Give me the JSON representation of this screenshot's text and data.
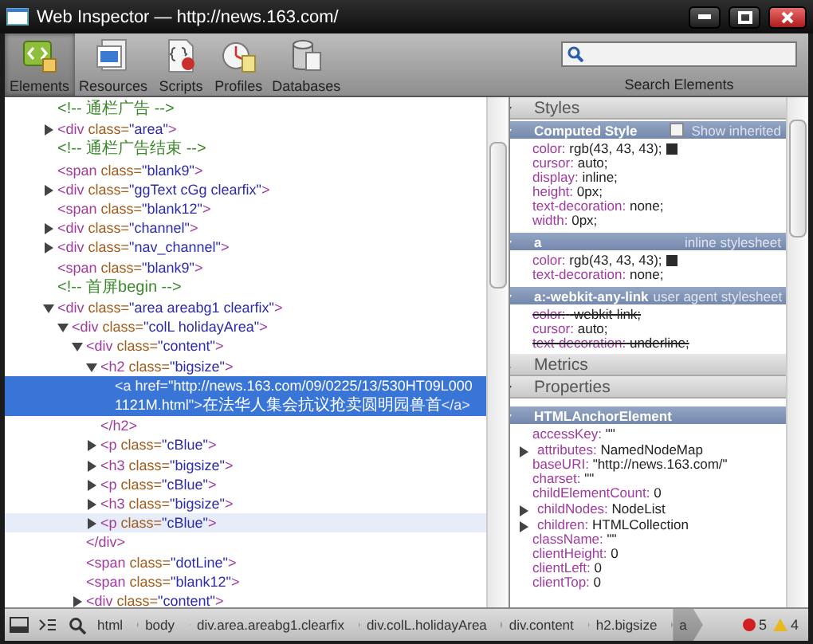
{
  "window": {
    "title": "Web Inspector — http://news.163.com/"
  },
  "toolbar": {
    "buttons": [
      {
        "label": "Elements",
        "kind": "elements",
        "selected": true
      },
      {
        "label": "Resources",
        "kind": "resources",
        "selected": false
      },
      {
        "label": "Scripts",
        "kind": "scripts",
        "selected": false
      },
      {
        "label": "Profiles",
        "kind": "profiles",
        "selected": false
      },
      {
        "label": "Databases",
        "kind": "databases",
        "selected": false
      }
    ],
    "search": {
      "label": "Search Elements"
    }
  },
  "dom_tree": [
    {
      "parts": [
        {
          "kind": "comment",
          "text": "<!-- 通栏广告 -->"
        }
      ],
      "selected": false,
      "hovered": false
    },
    {
      "parts": [
        {
          "kind": "tag",
          "text": "<div"
        },
        {
          "kind": "attr",
          "text": " class="
        },
        {
          "kind": "value",
          "text": "\"area\""
        },
        {
          "kind": "tag",
          "text": ">"
        }
      ],
      "expanded": false,
      "selected": false,
      "hovered": false
    },
    {
      "parts": [
        {
          "kind": "comment",
          "text": "<!-- 通栏广告结束 -->"
        }
      ],
      "selected": false,
      "hovered": false
    },
    {
      "parts": [
        {
          "kind": "tag",
          "text": "<span"
        },
        {
          "kind": "attr",
          "text": " class="
        },
        {
          "kind": "value",
          "text": "\"blank9\""
        },
        {
          "kind": "tag",
          "text": ">"
        }
      ],
      "selected": false,
      "hovered": false
    },
    {
      "parts": [
        {
          "kind": "tag",
          "text": "<div"
        },
        {
          "kind": "attr",
          "text": " class="
        },
        {
          "kind": "value",
          "text": "\"ggText cGg clearfix\""
        },
        {
          "kind": "tag",
          "text": ">"
        }
      ],
      "expanded": false,
      "selected": false,
      "hovered": false
    },
    {
      "parts": [
        {
          "kind": "tag",
          "text": "<span"
        },
        {
          "kind": "attr",
          "text": " class="
        },
        {
          "kind": "value",
          "text": "\"blank12\""
        },
        {
          "kind": "tag",
          "text": ">"
        }
      ],
      "selected": false,
      "hovered": false
    },
    {
      "parts": [
        {
          "kind": "tag",
          "text": "<div"
        },
        {
          "kind": "attr",
          "text": " class="
        },
        {
          "kind": "value",
          "text": "\"channel\""
        },
        {
          "kind": "tag",
          "text": ">"
        }
      ],
      "expanded": false,
      "selected": false,
      "hovered": false
    },
    {
      "parts": [
        {
          "kind": "tag",
          "text": "<div"
        },
        {
          "kind": "attr",
          "text": " class="
        },
        {
          "kind": "value",
          "text": "\"nav_channel\""
        },
        {
          "kind": "tag",
          "text": ">"
        }
      ],
      "expanded": false,
      "selected": false,
      "hovered": false
    },
    {
      "parts": [
        {
          "kind": "tag",
          "text": "<span"
        },
        {
          "kind": "attr",
          "text": " class="
        },
        {
          "kind": "value",
          "text": "\"blank9\""
        },
        {
          "kind": "tag",
          "text": ">"
        }
      ],
      "selected": false,
      "hovered": false
    },
    {
      "parts": [
        {
          "kind": "comment",
          "text": "<!-- 首屏begin -->"
        }
      ],
      "selected": false,
      "hovered": false
    },
    {
      "parts": [
        {
          "kind": "tag",
          "text": "<div"
        },
        {
          "kind": "attr",
          "text": " class="
        },
        {
          "kind": "value",
          "text": "\"area areabg1 clearfix\""
        },
        {
          "kind": "tag",
          "text": ">"
        }
      ],
      "expanded": true,
      "selected": false,
      "hovered": false,
      "children": [
        {
          "parts": [
            {
              "kind": "tag",
              "text": "<div"
            },
            {
              "kind": "attr",
              "text": " class="
            },
            {
              "kind": "value",
              "text": "\"colL holidayArea\""
            },
            {
              "kind": "tag",
              "text": ">"
            }
          ],
          "expanded": true,
          "selected": false,
          "hovered": false,
          "children": [
            {
              "parts": [
                {
                  "kind": "tag",
                  "text": "<div"
                },
                {
                  "kind": "attr",
                  "text": " class="
                },
                {
                  "kind": "value",
                  "text": "\"content\""
                },
                {
                  "kind": "tag",
                  "text": ">"
                }
              ],
              "expanded": true,
              "selected": false,
              "hovered": false,
              "closing": "</div>",
              "children": [
                {
                  "parts": [
                    {
                      "kind": "tag",
                      "text": "<h2"
                    },
                    {
                      "kind": "attr",
                      "text": " class="
                    },
                    {
                      "kind": "value",
                      "text": "\"bigsize\""
                    },
                    {
                      "kind": "tag",
                      "text": ">"
                    }
                  ],
                  "expanded": true,
                  "selected": false,
                  "hovered": false,
                  "closing": "</h2>",
                  "children": [
                    {
                      "parts": [
                        {
                          "kind": "tag",
                          "text": "<a"
                        },
                        {
                          "kind": "attr",
                          "text": " href="
                        },
                        {
                          "kind": "value",
                          "text": "\"http://news.163.com/09/0225/13/530HT09L0001121M.html\""
                        },
                        {
                          "kind": "tag",
                          "text": ">"
                        },
                        {
                          "kind": "text",
                          "text": "在法华人集会抗议抢卖圆明园兽首"
                        },
                        {
                          "kind": "tag",
                          "text": "</a>"
                        }
                      ],
                      "selected": true
                    }
                  ]
                },
                {
                  "parts": [
                    {
                      "kind": "tag",
                      "text": "<p"
                    },
                    {
                      "kind": "attr",
                      "text": " class="
                    },
                    {
                      "kind": "value",
                      "text": "\"cBlue\""
                    },
                    {
                      "kind": "tag",
                      "text": ">"
                    }
                  ],
                  "expanded": false,
                  "selected": false,
                  "hovered": false
                },
                {
                  "parts": [
                    {
                      "kind": "tag",
                      "text": "<h3"
                    },
                    {
                      "kind": "attr",
                      "text": " class="
                    },
                    {
                      "kind": "value",
                      "text": "\"bigsize\""
                    },
                    {
                      "kind": "tag",
                      "text": ">"
                    }
                  ],
                  "expanded": false,
                  "selected": false,
                  "hovered": false
                },
                {
                  "parts": [
                    {
                      "kind": "tag",
                      "text": "<p"
                    },
                    {
                      "kind": "attr",
                      "text": " class="
                    },
                    {
                      "kind": "value",
                      "text": "\"cBlue\""
                    },
                    {
                      "kind": "tag",
                      "text": ">"
                    }
                  ],
                  "expanded": false,
                  "selected": false,
                  "hovered": false
                },
                {
                  "parts": [
                    {
                      "kind": "tag",
                      "text": "<h3"
                    },
                    {
                      "kind": "attr",
                      "text": " class="
                    },
                    {
                      "kind": "value",
                      "text": "\"bigsize\""
                    },
                    {
                      "kind": "tag",
                      "text": ">"
                    }
                  ],
                  "expanded": false,
                  "selected": false,
                  "hovered": false
                },
                {
                  "parts": [
                    {
                      "kind": "tag",
                      "text": "<p"
                    },
                    {
                      "kind": "attr",
                      "text": " class="
                    },
                    {
                      "kind": "value",
                      "text": "\"cBlue\""
                    },
                    {
                      "kind": "tag",
                      "text": ">"
                    }
                  ],
                  "expanded": false,
                  "selected": false,
                  "hovered": true
                }
              ]
            },
            {
              "parts": [
                {
                  "kind": "tag",
                  "text": "<span"
                },
                {
                  "kind": "attr",
                  "text": " class="
                },
                {
                  "kind": "value",
                  "text": "\"dotLine\""
                },
                {
                  "kind": "tag",
                  "text": ">"
                }
              ],
              "selected": false,
              "hovered": false
            },
            {
              "parts": [
                {
                  "kind": "tag",
                  "text": "<span"
                },
                {
                  "kind": "attr",
                  "text": " class="
                },
                {
                  "kind": "value",
                  "text": "\"blank12\""
                },
                {
                  "kind": "tag",
                  "text": ">"
                }
              ],
              "selected": false,
              "hovered": false
            },
            {
              "parts": [
                {
                  "kind": "tag",
                  "text": "<div"
                },
                {
                  "kind": "attr",
                  "text": " class="
                },
                {
                  "kind": "value",
                  "text": "\"content\""
                },
                {
                  "kind": "tag",
                  "text": ">"
                }
              ],
              "expanded": false,
              "selected": false,
              "hovered": false
            }
          ]
        }
      ]
    }
  ],
  "styles": {
    "title": "Styles",
    "expanded": true,
    "rules": [
      {
        "selector": "Computed Style",
        "expanded": true,
        "show_inherited": {
          "label": "Show inherited",
          "checked": false
        },
        "properties": [
          {
            "name": "color:",
            "value": "rgb(43, 43, 43);",
            "color": "#2b2b2b",
            "overridden": false
          },
          {
            "name": "cursor:",
            "value": "auto;",
            "overridden": false
          },
          {
            "name": "display:",
            "value": "inline;",
            "overridden": false
          },
          {
            "name": "height:",
            "value": "0px;",
            "overridden": false
          },
          {
            "name": "text-decoration:",
            "value": "none;",
            "overridden": false
          },
          {
            "name": "width:",
            "value": "0px;",
            "overridden": false
          }
        ]
      },
      {
        "selector": "a",
        "source": "inline stylesheet",
        "expanded": true,
        "properties": [
          {
            "name": "color:",
            "value": "rgb(43, 43, 43);",
            "color": "#2b2b2b",
            "overridden": false
          },
          {
            "name": "text-decoration:",
            "value": "none;",
            "overridden": false
          }
        ]
      },
      {
        "selector": "a:-webkit-any-link",
        "source": "user agent stylesheet",
        "expanded": true,
        "properties": [
          {
            "name": "color:",
            "value": "-webkit-link;",
            "overridden": true
          },
          {
            "name": "cursor:",
            "value": "auto;",
            "overridden": false
          },
          {
            "name": "text-decoration:",
            "value": "underline;",
            "overridden": true
          }
        ]
      }
    ]
  },
  "metrics": {
    "title": "Metrics",
    "expanded": false
  },
  "properties": {
    "title": "Properties",
    "expanded": true,
    "groups": [
      {
        "title": "HTMLAnchorElement",
        "expanded": true,
        "items": [
          {
            "name": "accessKey:",
            "value": "\"\"",
            "expandable": false
          },
          {
            "name": "attributes:",
            "value": "NamedNodeMap",
            "expandable": true
          },
          {
            "name": "baseURI:",
            "value": "\"http://news.163.com/\"",
            "expandable": false
          },
          {
            "name": "charset:",
            "value": "\"\"",
            "expandable": false
          },
          {
            "name": "childElementCount:",
            "value": "0",
            "expandable": false
          },
          {
            "name": "childNodes:",
            "value": "NodeList",
            "expandable": true
          },
          {
            "name": "children:",
            "value": "HTMLCollection",
            "expandable": true
          },
          {
            "name": "className:",
            "value": "\"\"",
            "expandable": false
          },
          {
            "name": "clientHeight:",
            "value": "0",
            "expandable": false
          },
          {
            "name": "clientLeft:",
            "value": "0",
            "expandable": false
          },
          {
            "name": "clientTop:",
            "value": "0",
            "expandable": false
          }
        ]
      }
    ]
  },
  "status_bar": {
    "breadcrumbs": [
      {
        "label": "html",
        "selected": false
      },
      {
        "label": "body",
        "selected": false
      },
      {
        "label": "div.area.areabg1.clearfix",
        "selected": false
      },
      {
        "label": "div.colL.holidayArea",
        "selected": false
      },
      {
        "label": "div.content",
        "selected": false
      },
      {
        "label": "h2.bigsize",
        "selected": false
      },
      {
        "label": "a",
        "selected": true
      }
    ],
    "errors": "5",
    "warnings": "4"
  }
}
